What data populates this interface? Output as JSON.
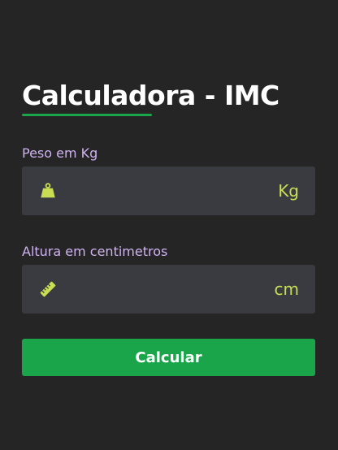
{
  "page": {
    "title": "Calculadora - IMC"
  },
  "weight": {
    "label": "Peso em Kg",
    "value": "",
    "unit": "Kg",
    "icon": "weight-icon"
  },
  "height": {
    "label": "Altura em centimetros",
    "value": "",
    "unit": "cm",
    "icon": "ruler-icon"
  },
  "calculate_button": {
    "label": "Calcular"
  },
  "colors": {
    "background": "#252525",
    "field_background": "#3a3b41",
    "accent_green": "#1aa54a",
    "label_color": "#cfb2f0",
    "icon_unit_color": "#c9de52"
  }
}
